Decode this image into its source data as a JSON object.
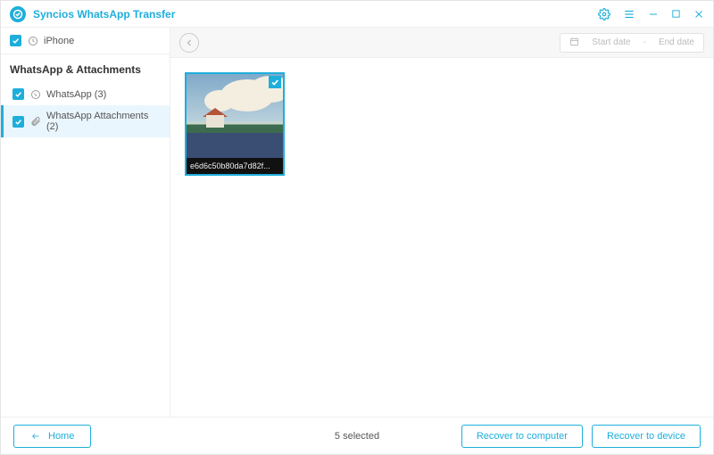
{
  "app": {
    "title": "Syncios WhatsApp Transfer"
  },
  "device": {
    "name": "iPhone",
    "checked": true
  },
  "sidebar": {
    "sectionTitle": "WhatsApp & Attachments",
    "items": [
      {
        "label": "WhatsApp (3)",
        "checked": true,
        "active": false
      },
      {
        "label": "WhatsApp Attachments (2)",
        "checked": true,
        "active": true
      }
    ]
  },
  "toolbar": {
    "dateStartPlaceholder": "Start date",
    "dateEndPlaceholder": "End date"
  },
  "thumbs": [
    {
      "filename": "e6d6c50b80da7d82f...",
      "selected": true
    }
  ],
  "footer": {
    "homeLabel": "Home",
    "statusText": "5 selected",
    "recoverComputerLabel": "Recover to computer",
    "recoverDeviceLabel": "Recover to device"
  }
}
